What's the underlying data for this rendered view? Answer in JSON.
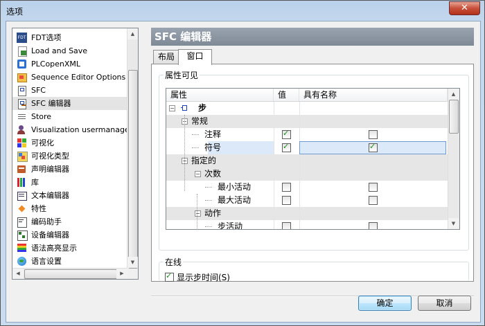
{
  "window": {
    "title": "选项",
    "close_label": "✕"
  },
  "sidebar": {
    "items": [
      {
        "label": "FDT选项",
        "icon": "fdt-icon"
      },
      {
        "label": "Load and Save",
        "icon": "load-save-icon"
      },
      {
        "label": "PLCopenXML",
        "icon": "plcopenxml-icon"
      },
      {
        "label": "Sequence Editor Options",
        "icon": "sequence-editor-icon"
      },
      {
        "label": "SFC",
        "icon": "sfc-icon"
      },
      {
        "label": "SFC 编辑器",
        "icon": "sfc-editor-icon",
        "selected": true
      },
      {
        "label": "Store",
        "icon": "store-icon"
      },
      {
        "label": "Visualization usermanagemer",
        "icon": "user-management-icon"
      },
      {
        "label": "可视化",
        "icon": "visualization-icon"
      },
      {
        "label": "可视化类型",
        "icon": "visualization-type-icon"
      },
      {
        "label": "声明编辑器",
        "icon": "declaration-editor-icon"
      },
      {
        "label": "库",
        "icon": "library-icon"
      },
      {
        "label": "文本编辑器",
        "icon": "text-editor-icon"
      },
      {
        "label": "特性",
        "icon": "features-icon"
      },
      {
        "label": "编码助手",
        "icon": "coding-assistant-icon"
      },
      {
        "label": "设备编辑器",
        "icon": "device-editor-icon"
      },
      {
        "label": "语法高亮显示",
        "icon": "syntax-highlight-icon"
      },
      {
        "label": "语言设置",
        "icon": "language-settings-icon"
      }
    ]
  },
  "panel": {
    "title": "SFC 编辑器",
    "tabs": [
      {
        "label": "布局"
      },
      {
        "label": "窗口"
      }
    ],
    "active_tab": "窗口",
    "properties_group": {
      "label": "属性可见",
      "columns": [
        "属性",
        "值",
        "具有名称"
      ],
      "rows": [
        {
          "label": "步",
          "level": 0,
          "bold": true,
          "value": null,
          "has_name": null,
          "gray": false
        },
        {
          "label": "常规",
          "level": 1,
          "value": null,
          "has_name": null,
          "gray": true
        },
        {
          "label": "注释",
          "level": 2,
          "value": true,
          "has_name": false,
          "gray": false
        },
        {
          "label": "符号",
          "level": 2,
          "value": true,
          "has_name": true,
          "gray": false,
          "highlighted": true
        },
        {
          "label": "指定的",
          "level": 1,
          "value": null,
          "has_name": null,
          "gray": true
        },
        {
          "label": "次数",
          "level": 2,
          "value": null,
          "has_name": null,
          "gray": true
        },
        {
          "label": "最小活动",
          "level": 3,
          "value": false,
          "has_name": false,
          "gray": false
        },
        {
          "label": "最大活动",
          "level": 3,
          "value": false,
          "has_name": false,
          "gray": false
        },
        {
          "label": "动作",
          "level": 2,
          "value": null,
          "has_name": null,
          "gray": true
        },
        {
          "label": "步活动",
          "level": 3,
          "value": false,
          "has_name": false,
          "gray": false
        }
      ]
    },
    "online_group": {
      "label": "在线",
      "show_step_time_label": "显示步时间(S)",
      "show_step_time_checked": true
    }
  },
  "buttons": {
    "ok": "确定",
    "cancel": "取消"
  },
  "colors": {
    "header": "#8a95a2",
    "selection": "#dce9f8",
    "check": "#1a8a1a"
  }
}
